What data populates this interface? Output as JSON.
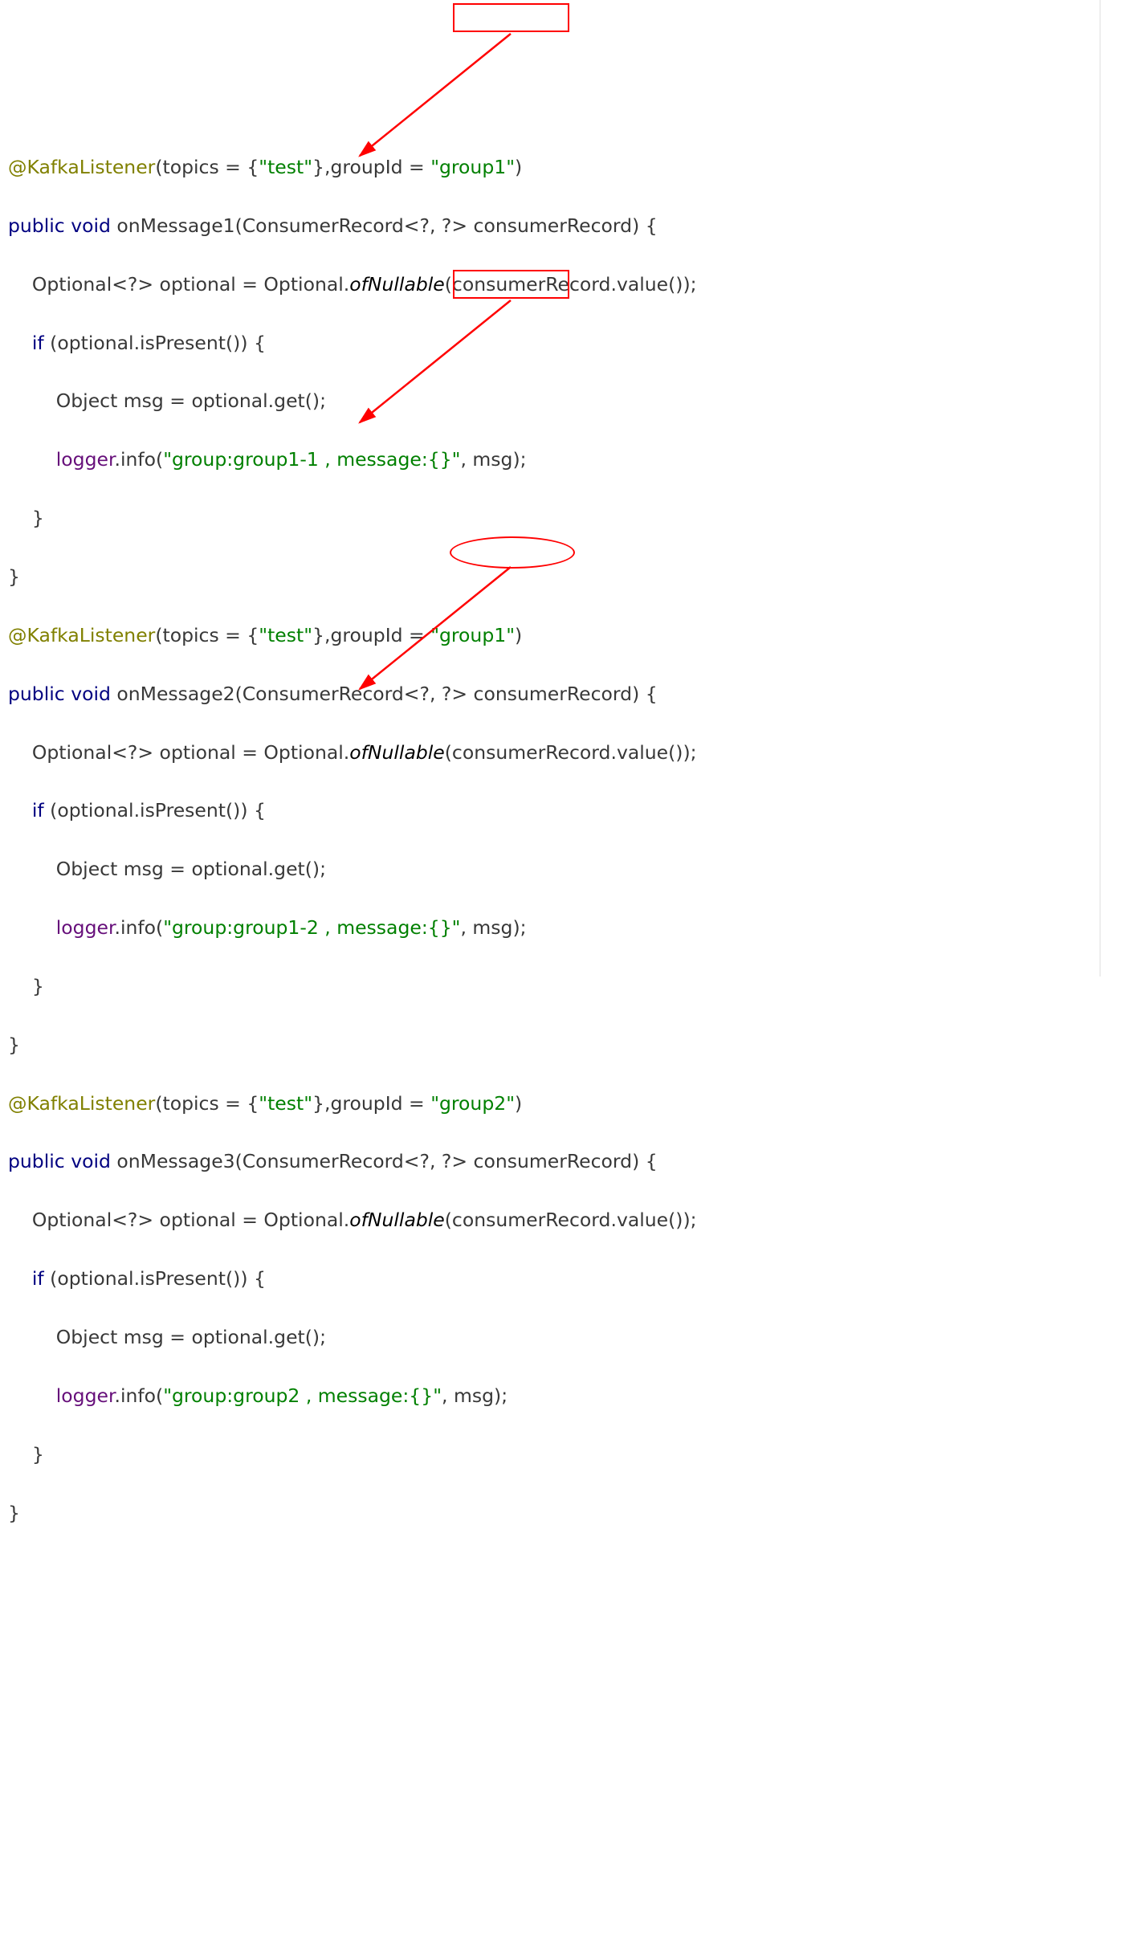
{
  "block1": {
    "anno": "@KafkaListener",
    "topics_k": "(topics = {",
    "topic": "\"test\"",
    "groupId_k": "},groupId = ",
    "groupId": "\"group1\"",
    "close": ")",
    "sig_kw1": "public ",
    "sig_kw2": "void ",
    "sig_name": "onMessage1(ConsumerRecord<?, ?> consumerRecord) {",
    "opt_line_a": "    Optional<?> optional = Optional.",
    "opt_line_b": "ofNullable",
    "opt_line_c": "(consumerRecord.value());",
    "if_kw": "    if ",
    "if_rest": "(optional.isPresent()) {",
    "obj": "        Object msg = optional.get();",
    "log_a": "        ",
    "log_b": "logger",
    "log_c": ".info(",
    "log_d": "\"group:group1-1 , message:{}\"",
    "log_e": ", msg);",
    "rb1": "    }",
    "rb2": "}"
  },
  "block2": {
    "anno": "@KafkaListener",
    "topics_k": "(topics = {",
    "topic": "\"test\"",
    "groupId_k": "},groupId = ",
    "groupId": "\"group1\"",
    "close": ")",
    "sig_kw1": "public ",
    "sig_kw2": "void ",
    "sig_name": "onMessage2(ConsumerRecord<?, ?> consumerRecord) {",
    "opt_line_a": "    Optional<?> optional = Optional.",
    "opt_line_b": "ofNullable",
    "opt_line_c": "(consumerRecord.value());",
    "if_kw": "    if ",
    "if_rest": "(optional.isPresent()) {",
    "obj": "        Object msg = optional.get();",
    "log_a": "        ",
    "log_b": "logger",
    "log_c": ".info(",
    "log_d": "\"group:group1-2 , message:{}\"",
    "log_e": ", msg);",
    "rb1": "    }",
    "rb2": "}"
  },
  "block3": {
    "anno": "@KafkaListener",
    "topics_k": "(topics = {",
    "topic": "\"test\"",
    "groupId_k": "},groupId = ",
    "groupId": "\"group2\"",
    "close": ")",
    "sig_kw1": "public ",
    "sig_kw2": "void ",
    "sig_name": "onMessage3(ConsumerRecord<?, ?> consumerRecord) {",
    "opt_line_a": "    Optional<?> optional = Optional.",
    "opt_line_b": "ofNullable",
    "opt_line_c": "(consumerRecord.value());",
    "if_kw": "    if ",
    "if_rest": "(optional.isPresent()) {",
    "obj": "        Object msg = optional.get();",
    "log_a": "        ",
    "log_b": "logger",
    "log_c": ".info(",
    "log_d": "\"group:group2 , message:{}\"",
    "log_e": ", msg);",
    "rb1": "    }",
    "rb2": "}"
  }
}
